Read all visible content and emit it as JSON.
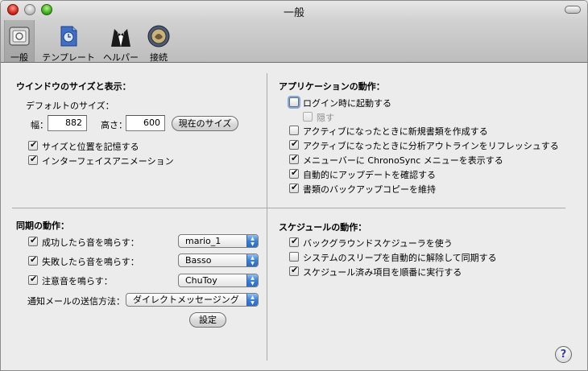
{
  "window": {
    "title": "一般"
  },
  "toolbar": {
    "items": [
      {
        "label": "一般",
        "icon": "general-prefs-icon"
      },
      {
        "label": "テンプレート",
        "icon": "template-document-icon"
      },
      {
        "label": "ヘルパー",
        "icon": "butler-helper-icon"
      },
      {
        "label": "接続",
        "icon": "connection-globe-icon"
      }
    ]
  },
  "window_display": {
    "title": "ウインドウのサイズと表示：",
    "default_size_label": "デフォルトのサイズ：",
    "width_label": "幅：",
    "width_value": "882",
    "height_label": "高さ：",
    "height_value": "600",
    "current_size_button": "現在のサイズ",
    "remember_label": "サイズと位置を記憶する",
    "remember_checked": true,
    "animation_label": "インターフェイスアニメーション",
    "animation_checked": true
  },
  "app_behavior": {
    "title": "アプリケーションの動作：",
    "launch_at_login": "ログイン時に起動する",
    "launch_at_login_checked": false,
    "hide": "隠す",
    "hide_checked": false,
    "new_doc": "アクティブになったときに新規書類を作成する",
    "new_doc_checked": false,
    "refresh_outline": "アクティブになったときに分析アウトラインをリフレッシュする",
    "refresh_outline_checked": true,
    "menubar": "メニューバーに ChronoSync メニューを表示する",
    "menubar_checked": true,
    "auto_update": "自動的にアップデートを確認する",
    "auto_update_checked": true,
    "backup_copy": "書類のバックアップコピーを維持",
    "backup_copy_checked": true
  },
  "sync_behavior": {
    "title": "同期の動作：",
    "success_label": "成功したら音を鳴らす：",
    "success_checked": true,
    "success_sound": "mario_1",
    "failure_label": "失敗したら音を鳴らす：",
    "failure_checked": true,
    "failure_sound": "Basso",
    "alert_label": "注意音を鳴らす：",
    "alert_checked": true,
    "alert_sound": "ChuToy",
    "mail_method_label": "通知メールの送信方法：",
    "mail_method": "ダイレクトメッセージング",
    "settings_button": "設定"
  },
  "schedule_behavior": {
    "title": "スケジュールの動作：",
    "background_scheduler": "バックグラウンドスケジューラを使う",
    "background_scheduler_checked": true,
    "sleep_sync": "システムのスリープを自動的に解除して同期する",
    "sleep_sync_checked": false,
    "run_in_order": "スケジュール済み項目を順番に実行する",
    "run_in_order_checked": true
  },
  "help": {
    "label": "?"
  },
  "colors": {
    "accent": "#3a7fd6",
    "window_bg": "#ececec"
  }
}
